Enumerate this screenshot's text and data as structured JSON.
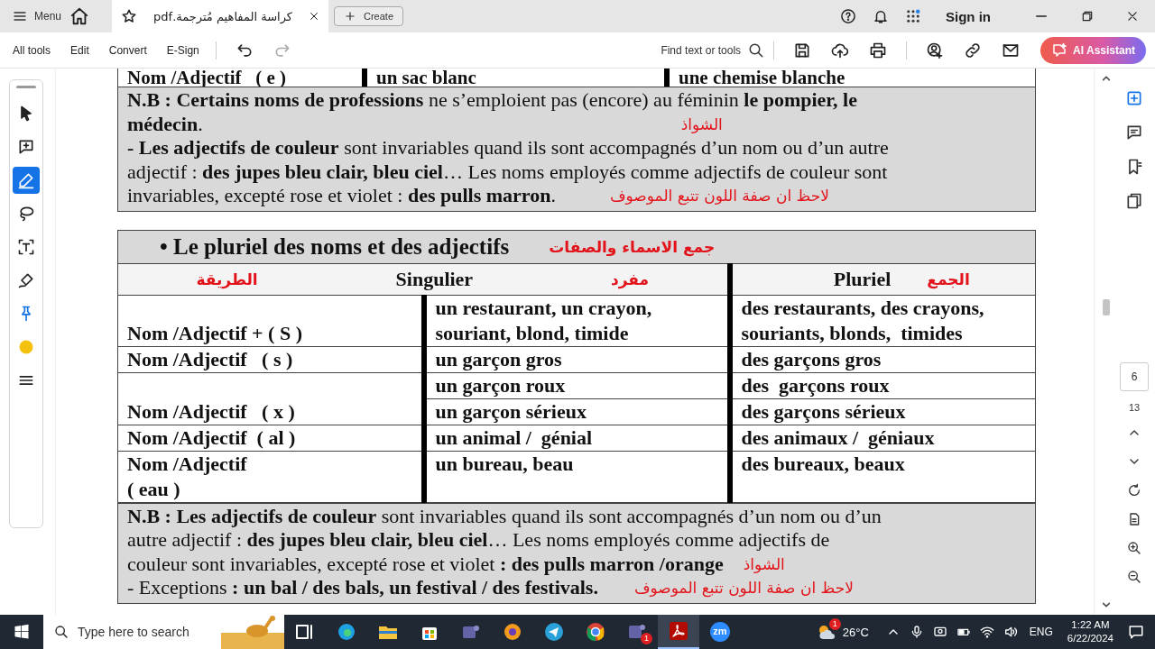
{
  "title_bar": {
    "menu_label": "Menu",
    "tabs": [
      {
        "title": "كراسة المفاهيم مُترجمة.pdf",
        "selected": true
      }
    ],
    "create_label": "Create",
    "sign_in": "Sign in"
  },
  "toolbar": {
    "menus": [
      "All tools",
      "Edit",
      "Convert",
      "E-Sign"
    ],
    "search_label": "Find text or tools",
    "ai_label": "AI Assistant"
  },
  "left_tools": [
    {
      "selected": false
    },
    {
      "selected": false
    },
    {
      "selected": true
    },
    {
      "selected": false
    },
    {
      "selected": false
    },
    {
      "selected": false
    },
    {
      "selected": false
    },
    {
      "selected": false
    },
    {
      "selected": false
    }
  ],
  "page_nav": {
    "current": "6",
    "total": "13"
  },
  "document": {
    "cut_row": [
      "Nom /Adjectif   ( e )",
      "un sac blanc",
      "une chemise blanche"
    ],
    "note_top": {
      "lines": [
        {
          "text": "**N.B : Certains noms de professions** ne s’emploient pas (encore) au féminin **le pompier, le**"
        },
        {
          "text": "**médecin**.",
          "annotation": "الشواذ"
        },
        {
          "text": "**- Les adjectifs de couleur** sont invariables quand ils sont accompagnés d’un nom ou d’un autre"
        },
        {
          "text": "adjectif : **des jupes bleu clair, bleu ciel**… Les noms employés comme adjectifs de couleur sont"
        },
        {
          "text": "invariables, excepté rose et violet : **des pulls marron**.",
          "annotation": "لاحظ ان صفة اللون تتبع الموصوف"
        }
      ]
    },
    "plural_table": {
      "title": "• Le pluriel des noms et des adjectifs",
      "title_note": "جمع الاسماء والصفات",
      "header": {
        "method_note": "الطريقة",
        "singular": "Singulier",
        "singular_note": "مفرد",
        "plural": "Pluriel",
        "plural_note": "الجمع"
      },
      "rows": [
        {
          "rule": "Nom /Adjectif + ( S )",
          "examples": [
            [
              "un restaurant, un crayon, souriant, blond, timide",
              "des restaurants, des crayons, souriants, blonds,  timides"
            ]
          ]
        },
        {
          "rule": "Nom /Adjectif   ( s )",
          "examples": [
            [
              "un garçon gros",
              "des garçons gros"
            ]
          ]
        },
        {
          "rule": "Nom /Adjectif   ( x )",
          "examples": [
            [
              "un garçon roux",
              "des  garçons roux"
            ],
            [
              "un garçon sérieux",
              "des garçons sérieux"
            ]
          ]
        },
        {
          "rule": "Nom /Adjectif  ( al )",
          "examples": [
            [
              "un animal /  génial",
              "des animaux /  géniaux"
            ]
          ]
        },
        {
          "rule": "Nom /Adjectif\n( eau )",
          "examples": [
            [
              "un bureau, beau",
              "des bureaux, beaux"
            ]
          ]
        }
      ]
    },
    "note_bottom": {
      "lines": [
        {
          "text": "**N.B : Les adjectifs de couleur** sont invariables quand ils sont accompagnés d’un nom ou d’un"
        },
        {
          "text": "autre adjectif : **des jupes bleu clair, bleu ciel**… Les noms employés comme adjectifs de"
        },
        {
          "text": "couleur sont invariables, excepté rose et violet **: des pulls marron /orange**",
          "annotation": "الشواذ"
        },
        {
          "text": "- Exceptions **: un bal / des bals, un festival / des festivals.**",
          "annotation": "لاحظ ان صفة اللون تتبع الموصوف"
        }
      ]
    }
  },
  "taskbar": {
    "search_placeholder": "Type here to search",
    "apps": [
      {
        "selected": false
      },
      {
        "selected": false
      },
      {
        "selected": false
      },
      {
        "selected": false
      },
      {
        "selected": false
      },
      {
        "selected": false
      },
      {
        "selected": false
      },
      {
        "selected": false
      },
      {
        "selected": false,
        "badge": "1"
      },
      {
        "selected": true
      },
      {
        "selected": false,
        "label": "zm"
      }
    ],
    "weather": {
      "temperature": "26°C",
      "badge": "1"
    },
    "language": "ENG",
    "time": "1:22 AM",
    "date": "6/22/2024"
  }
}
